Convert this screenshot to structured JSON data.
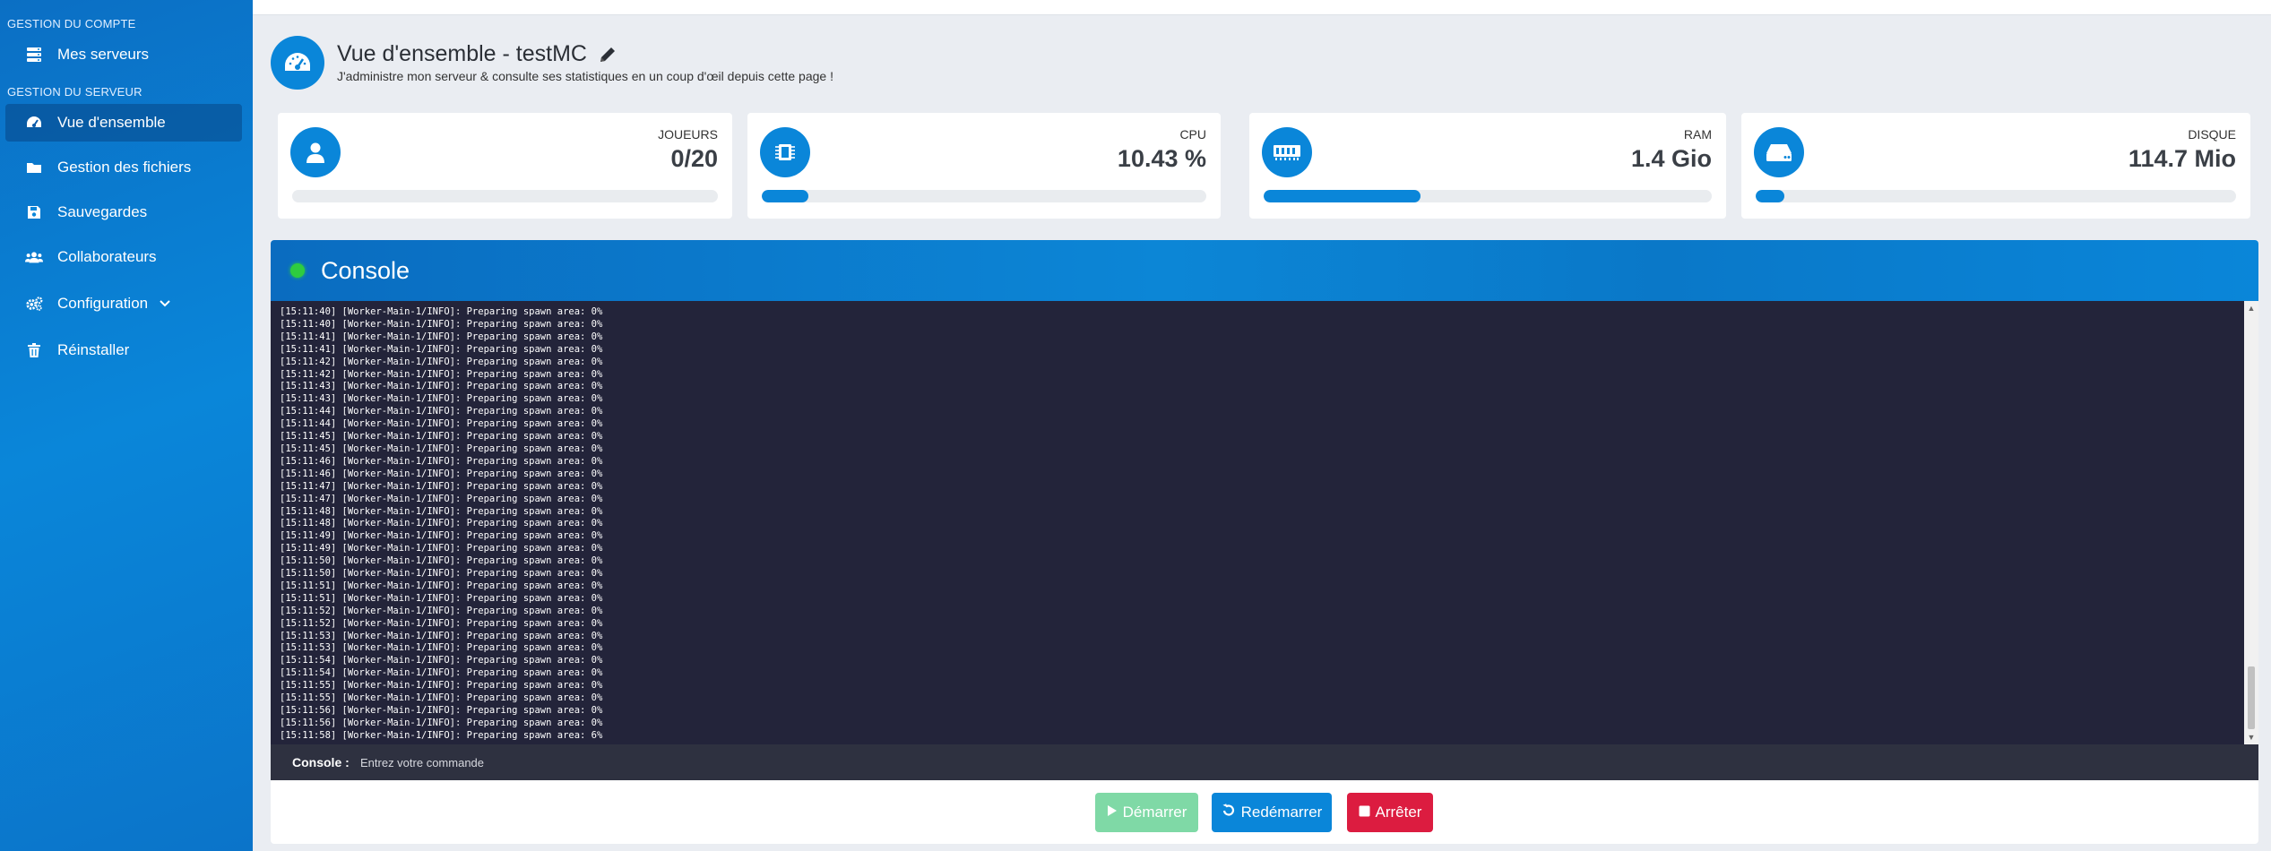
{
  "sidebar": {
    "section_account": "GESTION DU COMPTE",
    "section_server": "GESTION DU SERVEUR",
    "items": [
      {
        "label": "Mes serveurs",
        "icon": "server-icon"
      },
      {
        "label": "Vue d'ensemble",
        "icon": "dashboard-icon",
        "active": true
      },
      {
        "label": "Gestion des fichiers",
        "icon": "folder-icon"
      },
      {
        "label": "Sauvegardes",
        "icon": "save-icon"
      },
      {
        "label": "Collaborateurs",
        "icon": "users-icon"
      },
      {
        "label": "Configuration",
        "icon": "cogs-icon"
      },
      {
        "label": "Réinstaller",
        "icon": "trash-icon"
      }
    ]
  },
  "header": {
    "title": "Vue d'ensemble - testMC",
    "subtitle": "J'administre mon serveur & consulte ses statistiques en un coup d'œil depuis cette page !"
  },
  "stats": [
    {
      "label": "JOUEURS",
      "value": "0/20",
      "progress": 0
    },
    {
      "label": "CPU",
      "value": "10.43 %",
      "progress": 10.43
    },
    {
      "label": "RAM",
      "value": "1.4 Gio",
      "progress": 35
    },
    {
      "label": "DISQUE",
      "value": "114.7 Mio",
      "progress": 6
    }
  ],
  "console": {
    "title": "Console",
    "status_color": "#2ecc40",
    "log_lines": [
      "[15:11:40] [Worker-Main-1/INFO]: Preparing spawn area: 0%",
      "[15:11:40] [Worker-Main-1/INFO]: Preparing spawn area: 0%",
      "[15:11:41] [Worker-Main-1/INFO]: Preparing spawn area: 0%",
      "[15:11:41] [Worker-Main-1/INFO]: Preparing spawn area: 0%",
      "[15:11:42] [Worker-Main-1/INFO]: Preparing spawn area: 0%",
      "[15:11:42] [Worker-Main-1/INFO]: Preparing spawn area: 0%",
      "[15:11:43] [Worker-Main-1/INFO]: Preparing spawn area: 0%",
      "[15:11:43] [Worker-Main-1/INFO]: Preparing spawn area: 0%",
      "[15:11:44] [Worker-Main-1/INFO]: Preparing spawn area: 0%",
      "[15:11:44] [Worker-Main-1/INFO]: Preparing spawn area: 0%",
      "[15:11:45] [Worker-Main-1/INFO]: Preparing spawn area: 0%",
      "[15:11:45] [Worker-Main-1/INFO]: Preparing spawn area: 0%",
      "[15:11:46] [Worker-Main-1/INFO]: Preparing spawn area: 0%",
      "[15:11:46] [Worker-Main-1/INFO]: Preparing spawn area: 0%",
      "[15:11:47] [Worker-Main-1/INFO]: Preparing spawn area: 0%",
      "[15:11:47] [Worker-Main-1/INFO]: Preparing spawn area: 0%",
      "[15:11:48] [Worker-Main-1/INFO]: Preparing spawn area: 0%",
      "[15:11:48] [Worker-Main-1/INFO]: Preparing spawn area: 0%",
      "[15:11:49] [Worker-Main-1/INFO]: Preparing spawn area: 0%",
      "[15:11:49] [Worker-Main-1/INFO]: Preparing spawn area: 0%",
      "[15:11:50] [Worker-Main-1/INFO]: Preparing spawn area: 0%",
      "[15:11:50] [Worker-Main-1/INFO]: Preparing spawn area: 0%",
      "[15:11:51] [Worker-Main-1/INFO]: Preparing spawn area: 0%",
      "[15:11:51] [Worker-Main-1/INFO]: Preparing spawn area: 0%",
      "[15:11:52] [Worker-Main-1/INFO]: Preparing spawn area: 0%",
      "[15:11:52] [Worker-Main-1/INFO]: Preparing spawn area: 0%",
      "[15:11:53] [Worker-Main-1/INFO]: Preparing spawn area: 0%",
      "[15:11:53] [Worker-Main-1/INFO]: Preparing spawn area: 0%",
      "[15:11:54] [Worker-Main-1/INFO]: Preparing spawn area: 0%",
      "[15:11:54] [Worker-Main-1/INFO]: Preparing spawn area: 0%",
      "[15:11:55] [Worker-Main-1/INFO]: Preparing spawn area: 0%",
      "[15:11:55] [Worker-Main-1/INFO]: Preparing spawn area: 0%",
      "[15:11:56] [Worker-Main-1/INFO]: Preparing spawn area: 0%",
      "[15:11:56] [Worker-Main-1/INFO]: Preparing spawn area: 0%",
      "[15:11:58] [Worker-Main-1/INFO]: Preparing spawn area: 6%"
    ],
    "command_label": "Console :",
    "command_placeholder": "Entrez votre commande"
  },
  "buttons": {
    "start": "Démarrer",
    "restart": "Redémarrer",
    "stop": "Arrêter"
  },
  "colors": {
    "accent": "#0a86d9",
    "start": "#7fd9a6",
    "stop": "#dc1c40",
    "console_bg": "#23243a"
  }
}
